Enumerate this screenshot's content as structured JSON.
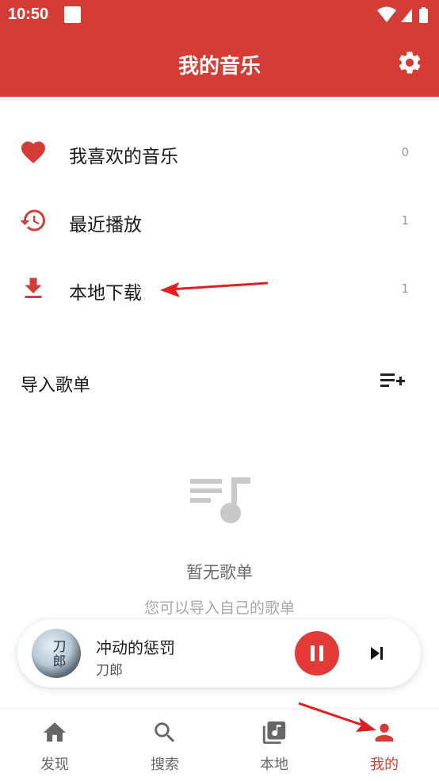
{
  "status_bar": {
    "time": "10:50"
  },
  "app_bar": {
    "title": "我的音乐"
  },
  "menu": [
    {
      "label": "我喜欢的音乐",
      "count": "0",
      "icon": "heart-icon"
    },
    {
      "label": "最近播放",
      "count": "1",
      "icon": "history-icon"
    },
    {
      "label": "本地下载",
      "count": "1",
      "icon": "download-icon"
    }
  ],
  "playlists": {
    "section_title": "导入歌单",
    "empty_title": "暂无歌单",
    "empty_subtitle": "您可以导入自己的歌单"
  },
  "player": {
    "song": "冲动的惩罚",
    "artist": "刀郎",
    "cover_text": "刀郎",
    "state": "playing"
  },
  "bottom_nav": [
    {
      "label": "发现",
      "icon": "home-icon",
      "active": false
    },
    {
      "label": "搜索",
      "icon": "search-icon",
      "active": false
    },
    {
      "label": "本地",
      "icon": "library-music-icon",
      "active": false
    },
    {
      "label": "我的",
      "icon": "person-icon",
      "active": true
    }
  ],
  "colors": {
    "primary": "#d33d36",
    "accent": "#e23a37",
    "annotation_arrow": "#e02020"
  }
}
